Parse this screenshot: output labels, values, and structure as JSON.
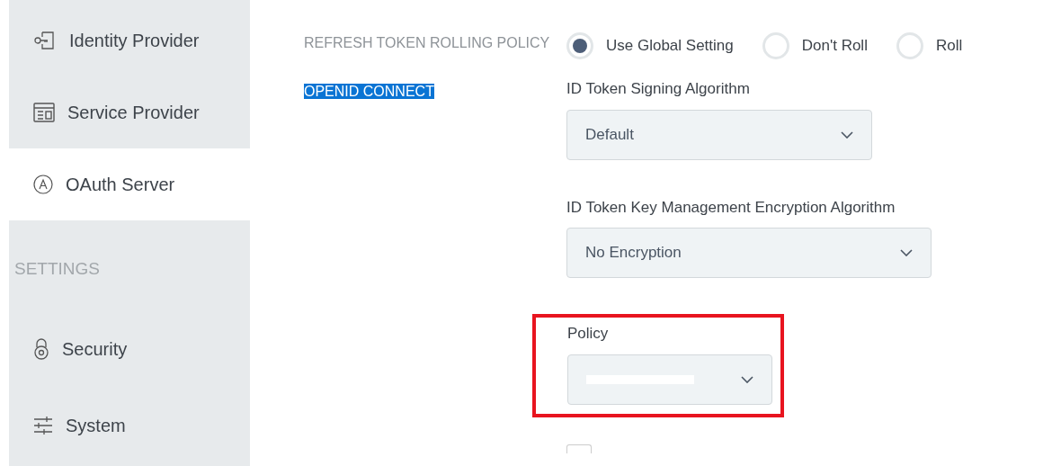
{
  "sidebar": {
    "items": [
      {
        "label": "Identity Provider",
        "selected": false
      },
      {
        "label": "Service Provider",
        "selected": false
      },
      {
        "label": "OAuth Server",
        "selected": true
      }
    ],
    "section_heading": "SETTINGS",
    "settings_items": [
      {
        "label": "Security",
        "selected": false
      },
      {
        "label": "System",
        "selected": false
      }
    ]
  },
  "refresh_token_rolling_policy": {
    "label": "REFRESH TOKEN ROLLING POLICY",
    "options": [
      {
        "label": "Use Global Setting",
        "selected": true
      },
      {
        "label": "Don't Roll",
        "selected": false
      },
      {
        "label": "Roll",
        "selected": false
      }
    ]
  },
  "openid_connect": {
    "heading": "OPENID CONNECT",
    "highlighted": true,
    "fields": [
      {
        "label": "ID Token Signing Algorithm",
        "value": "Default"
      },
      {
        "label": "ID Token Key Management Encryption Algorithm",
        "value": "No Encryption"
      },
      {
        "label": "Policy",
        "redacted": true,
        "outlined": true
      }
    ],
    "checkbox": {
      "checked": false
    }
  }
}
